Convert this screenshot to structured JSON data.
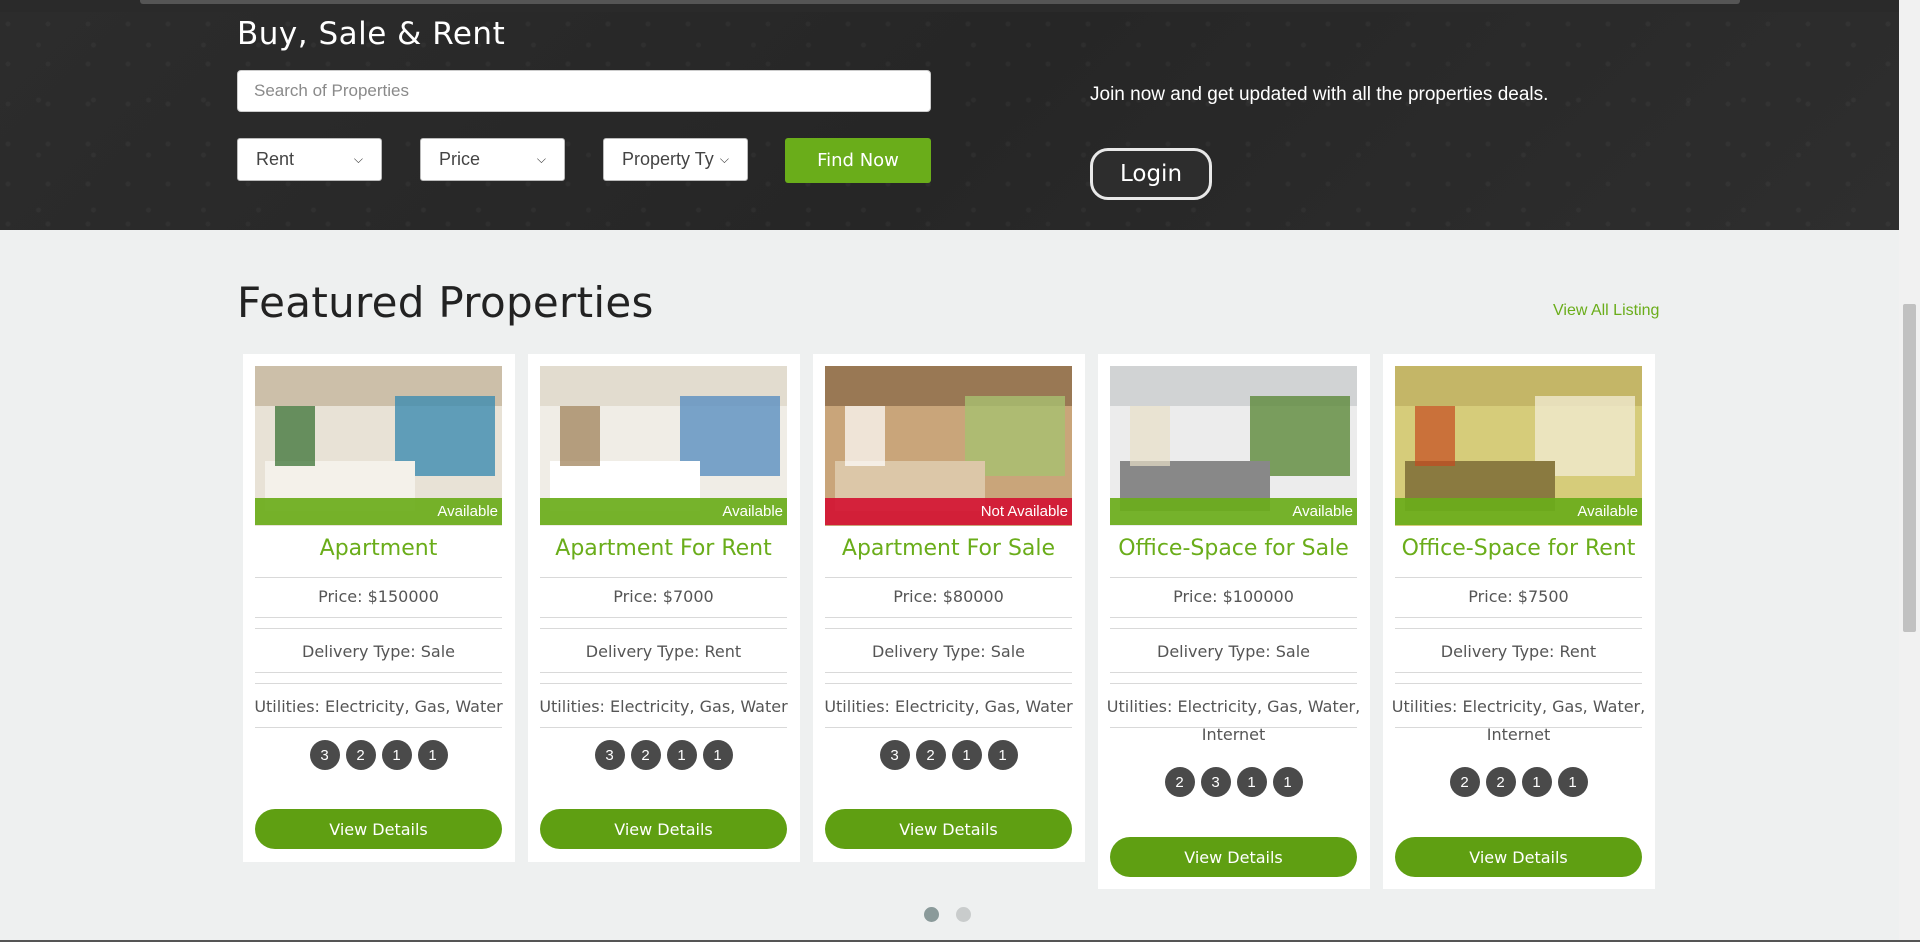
{
  "hero": {
    "title": "Buy, Sale & Rent",
    "search_placeholder": "Search of Properties",
    "filters": [
      {
        "label": "Rent"
      },
      {
        "label": "Price"
      },
      {
        "label": "Property Ty"
      }
    ],
    "find_label": "Find Now",
    "join_text": "Join now and get updated with all the properties deals.",
    "login_label": "Login"
  },
  "featured": {
    "title": "Featured Properties",
    "view_all": "View All Listing",
    "cards": [
      {
        "status": "Available",
        "status_color": "#6aad1a",
        "name": "Apartment",
        "price": "Price: $150000",
        "delivery": "Delivery Type: Sale",
        "utilities": "Utilities: Electricity, Gas, Water",
        "badges": [
          "3",
          "2",
          "1",
          "1"
        ],
        "button": "View Details"
      },
      {
        "status": "Available",
        "status_color": "#6aad1a",
        "name": "Apartment For Rent",
        "price": "Price: $7000",
        "delivery": "Delivery Type: Rent",
        "utilities": "Utilities: Electricity, Gas, Water",
        "badges": [
          "3",
          "2",
          "1",
          "1"
        ],
        "button": "View Details"
      },
      {
        "status": "Not Available",
        "status_color": "#d21432",
        "name": "Apartment For Sale",
        "price": "Price: $80000",
        "delivery": "Delivery Type: Sale",
        "utilities": "Utilities: Electricity, Gas, Water",
        "badges": [
          "3",
          "2",
          "1",
          "1"
        ],
        "button": "View Details"
      },
      {
        "status": "Available",
        "status_color": "#6aad1a",
        "name": "Office-Space for Sale",
        "price": "Price: $100000",
        "delivery": "Delivery Type: Sale",
        "utilities": "Utilities: Electricity, Gas, Water, Internet",
        "badges": [
          "2",
          "3",
          "1",
          "1"
        ],
        "button": "View Details"
      },
      {
        "status": "Available",
        "status_color": "#6aad1a",
        "name": "Office-Space for Rent",
        "price": "Price: $7500",
        "delivery": "Delivery Type: Rent",
        "utilities": "Utilities: Electricity, Gas, Water, Internet",
        "badges": [
          "2",
          "2",
          "1",
          "1"
        ],
        "button": "View Details"
      }
    ]
  },
  "colors": {
    "accent": "#6aad1a",
    "unavailable": "#d21432",
    "hero_bg": "#2b2b2b"
  }
}
